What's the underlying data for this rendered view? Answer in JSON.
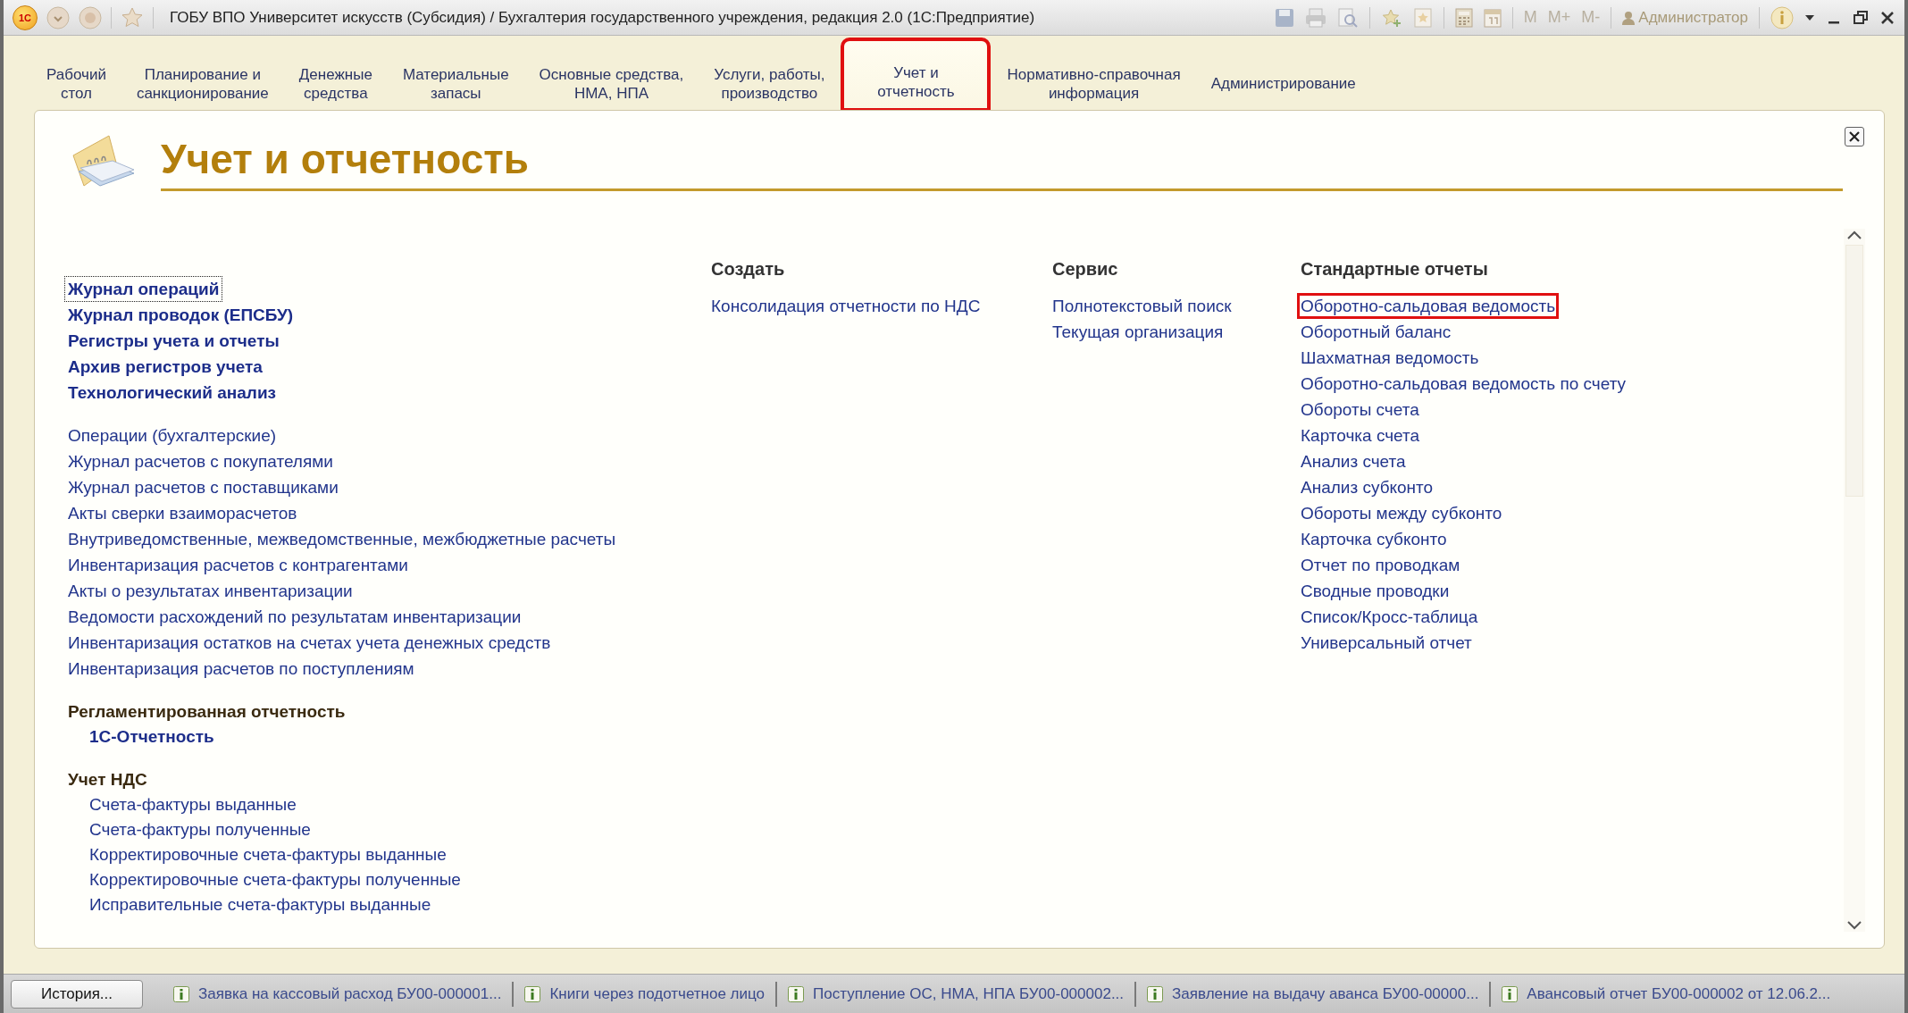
{
  "window": {
    "logo": "1С",
    "title": "ГОБУ ВПО Университет искусств (Субсидия) / Бухгалтерия государственного учреждения, редакция 2.0  (1С:Предприятие)"
  },
  "toolbar": {
    "memory_buttons": [
      "M",
      "M+",
      "M-"
    ],
    "user": "Администратор"
  },
  "tabs": [
    {
      "label": "Рабочий\nстол",
      "selected": false,
      "highlighted": false
    },
    {
      "label": "Планирование и\nсанкционирование",
      "selected": false,
      "highlighted": false
    },
    {
      "label": "Денежные\nсредства",
      "selected": false,
      "highlighted": false
    },
    {
      "label": "Материальные\nзапасы",
      "selected": false,
      "highlighted": false
    },
    {
      "label": "Основные средства,\nНМА, НПА",
      "selected": false,
      "highlighted": false
    },
    {
      "label": "Услуги, работы,\nпроизводство",
      "selected": false,
      "highlighted": false
    },
    {
      "label": "Учет и\nотчетность",
      "selected": true,
      "highlighted": true
    },
    {
      "label": "Нормативно-справочная\nинформация",
      "selected": false,
      "highlighted": false
    },
    {
      "label": "Администрирование",
      "selected": false,
      "highlighted": false
    }
  ],
  "section": {
    "title": "Учет и отчетность"
  },
  "left_groups": [
    {
      "kind": "bold_links",
      "items": [
        {
          "label": "Журнал операций",
          "focused": true
        },
        {
          "label": "Журнал проводок (ЕПСБУ)",
          "focused": false
        },
        {
          "label": "Регистры учета и отчеты",
          "focused": false
        },
        {
          "label": "Архив регистров учета",
          "focused": false
        },
        {
          "label": "Технологический анализ",
          "focused": false
        }
      ]
    },
    {
      "kind": "links",
      "items": [
        {
          "label": "Операции (бухгалтерские)"
        },
        {
          "label": "Журнал расчетов с покупателями"
        },
        {
          "label": "Журнал расчетов с поставщиками"
        },
        {
          "label": "Акты сверки взаиморасчетов"
        },
        {
          "label": "Внутриведомственные, межведомственные, межбюджетные расчеты"
        },
        {
          "label": "Инвентаризация расчетов с контрагентами"
        },
        {
          "label": "Акты о результатах инвентаризации"
        },
        {
          "label": "Ведомости расхождений по результатам инвентаризации"
        },
        {
          "label": "Инвентаризация остатков на счетах учета денежных средств"
        },
        {
          "label": "Инвентаризация расчетов по поступлениям"
        }
      ]
    },
    {
      "kind": "subsection_bold",
      "title": "Регламентированная отчетность",
      "items": [
        {
          "label": "1С-Отчетность"
        }
      ]
    },
    {
      "kind": "subsection",
      "title": "Учет НДС",
      "items": [
        {
          "label": "Счета-фактуры выданные"
        },
        {
          "label": "Счета-фактуры полученные"
        },
        {
          "label": "Корректировочные счета-фактуры выданные"
        },
        {
          "label": "Корректировочные счета-фактуры полученные"
        },
        {
          "label": "Исправительные счета-фактуры выданные"
        }
      ]
    }
  ],
  "columns": [
    {
      "title": "Создать",
      "items": [
        {
          "label": "Консолидация отчетности по НДС",
          "highlighted": false
        }
      ]
    },
    {
      "title": "Сервис",
      "items": [
        {
          "label": "Полнотекстовый поиск",
          "highlighted": false
        },
        {
          "label": "Текущая организация",
          "highlighted": false
        }
      ]
    },
    {
      "title": "Стандартные отчеты",
      "items": [
        {
          "label": "Оборотно-сальдовая ведомость",
          "highlighted": true
        },
        {
          "label": "Оборотный баланс",
          "highlighted": false
        },
        {
          "label": "Шахматная ведомость",
          "highlighted": false
        },
        {
          "label": "Оборотно-сальдовая ведомость по счету",
          "highlighted": false
        },
        {
          "label": "Обороты счета",
          "highlighted": false
        },
        {
          "label": "Карточка счета",
          "highlighted": false
        },
        {
          "label": "Анализ счета",
          "highlighted": false
        },
        {
          "label": "Анализ субконто",
          "highlighted": false
        },
        {
          "label": "Обороты между субконто",
          "highlighted": false
        },
        {
          "label": "Карточка субконто",
          "highlighted": false
        },
        {
          "label": "Отчет по проводкам",
          "highlighted": false
        },
        {
          "label": "Сводные проводки",
          "highlighted": false
        },
        {
          "label": "Список/Кросс-таблица",
          "highlighted": false
        },
        {
          "label": "Универсальный отчет",
          "highlighted": false
        }
      ]
    }
  ],
  "taskbar": {
    "history_button": "История...",
    "items": [
      "Заявка на кассовый расход БУ00-000001...",
      "Книги через подотчетное лицо",
      "Поступление ОС, НМА, НПА БУ00-000002...",
      "Заявление на выдачу аванса БУ00-00000...",
      "Авансовый отчет БУ00-000002 от 12.06.2..."
    ]
  }
}
